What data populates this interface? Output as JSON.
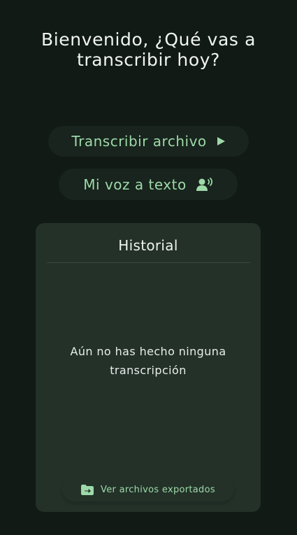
{
  "welcome": {
    "line1": "Bienvenido, ¿Qué vas a",
    "line2": "transcribir hoy?"
  },
  "actions": {
    "transcribe_file_label": "Transcribir archivo",
    "transcribe_file_icon": "play-icon",
    "voice_to_text_label": "Mi voz a texto",
    "voice_to_text_icon": "speaking-person-icon"
  },
  "history": {
    "title": "Historial",
    "empty_line1": "Aún no has hecho ninguna",
    "empty_line2": "transcripción",
    "exported_label": "Ver archivos exportados",
    "exported_icon": "folder-export-icon"
  },
  "colors": {
    "background": "#111a15",
    "card": "#233129",
    "pill": "#18241d",
    "accent": "#9ed9a8",
    "text": "#eef3ef"
  }
}
